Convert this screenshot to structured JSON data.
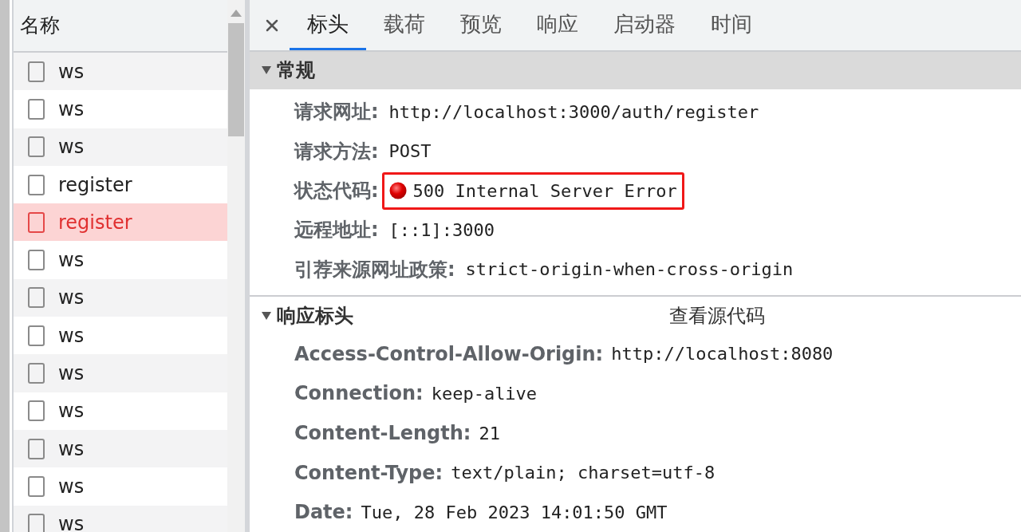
{
  "sidebar": {
    "header": "名称",
    "items": [
      {
        "name": "ws",
        "selected": false
      },
      {
        "name": "ws",
        "selected": false
      },
      {
        "name": "ws",
        "selected": false
      },
      {
        "name": "register",
        "selected": false
      },
      {
        "name": "register",
        "selected": true
      },
      {
        "name": "ws",
        "selected": false
      },
      {
        "name": "ws",
        "selected": false
      },
      {
        "name": "ws",
        "selected": false
      },
      {
        "name": "ws",
        "selected": false
      },
      {
        "name": "ws",
        "selected": false
      },
      {
        "name": "ws",
        "selected": false
      },
      {
        "name": "ws",
        "selected": false
      },
      {
        "name": "ws",
        "selected": false
      }
    ]
  },
  "tabs": [
    {
      "label": "标头",
      "selected": true
    },
    {
      "label": "载荷",
      "selected": false
    },
    {
      "label": "预览",
      "selected": false
    },
    {
      "label": "响应",
      "selected": false
    },
    {
      "label": "启动器",
      "selected": false
    },
    {
      "label": "时间",
      "selected": false
    }
  ],
  "general": {
    "title": "常规",
    "expanded": true,
    "rows": [
      {
        "label": "请求网址:",
        "value": "http://localhost:3000/auth/register",
        "highlighted": false
      },
      {
        "label": "请求方法:",
        "value": "POST",
        "highlighted": false
      },
      {
        "label": "状态代码:",
        "value": "500 Internal Server Error",
        "highlighted": true,
        "kind": "status"
      },
      {
        "label": "远程地址:",
        "value": "[::1]:3000",
        "highlighted": false
      },
      {
        "label": "引荐来源网址政策:",
        "value": "strict-origin-when-cross-origin",
        "highlighted": false
      }
    ]
  },
  "response_headers": {
    "title": "响应标头",
    "expanded": true,
    "view_source": "查看源代码",
    "rows": [
      {
        "label": "Access-Control-Allow-Origin:",
        "value": "http://localhost:8080"
      },
      {
        "label": "Connection:",
        "value": "keep-alive"
      },
      {
        "label": "Content-Length:",
        "value": "21"
      },
      {
        "label": "Content-Type:",
        "value": "text/plain; charset=utf-8"
      },
      {
        "label": "Date:",
        "value": "Tue, 28 Feb 2023 14:01:50 GMT"
      }
    ]
  }
}
